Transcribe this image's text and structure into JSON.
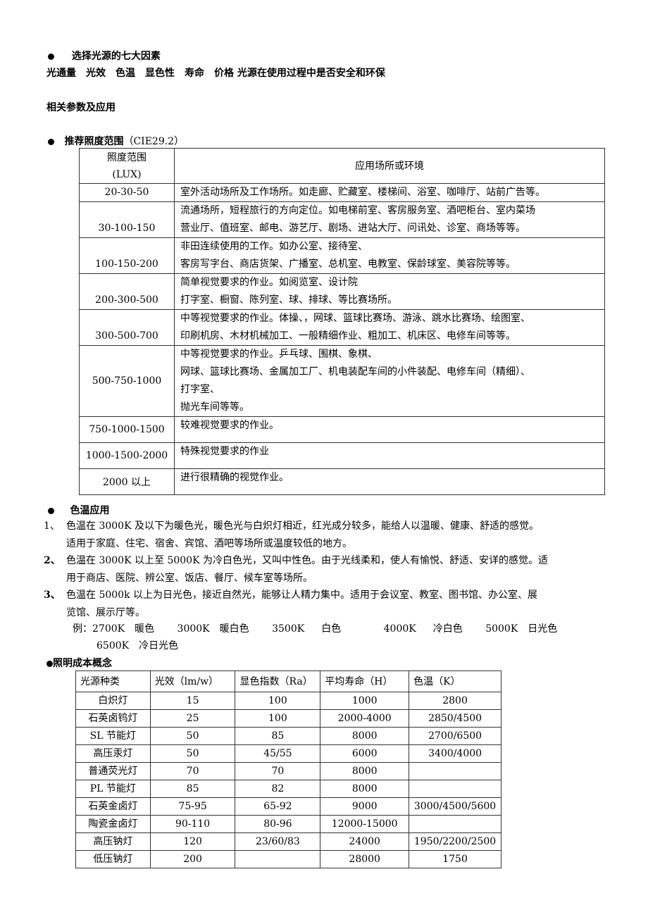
{
  "section1": {
    "title": "选择光源的七大因素",
    "factors_line": "光通量　光效　色温　显色性　寿命　价格 光源在使用过程中是否安全和环保"
  },
  "section2": {
    "title": "相关参数及应用"
  },
  "lux_section": {
    "title": "推荐照度范围",
    "title_suffix": "（CIE29.2）",
    "header": {
      "range_line1": "照度范围",
      "range_line2": "(LUX)",
      "application": "应用场所或环境"
    },
    "rows": [
      {
        "range": "20-30-50",
        "lines": [
          "室外活动场所及工作场所。如走廊、贮藏室、楼梯间、浴室、咖啡厅、站前广告等。"
        ]
      },
      {
        "range": "30-100-150",
        "lines": [
          "流通场所，短程旅行的方向定位。如电梯前室、客房服务室、酒吧柜台、室内菜场",
          "营业厅、值班室、邮电、游艺厅、剧场、进站大厅、问讯处、诊室、商场等等。"
        ]
      },
      {
        "range": "100-150-200",
        "lines": [
          "非田连续使用的工作。如办公室、接待室、",
          "客房写字台、商店货架、广播室、总机室、电教室、保龄球室、美容院等等。"
        ]
      },
      {
        "range": "200-300-500",
        "lines": [
          "简单视觉要求的作业。如阅览室、设计院",
          "打字室、橱窗、陈列室、球、排球、等比赛场所。"
        ]
      },
      {
        "range": "300-500-700",
        "lines": [
          "中等视觉要求的作业。体操、，网球、篮球比赛场、游泳、跳水比赛场、绘图室、",
          "印刷机房、木材机械加工、一般精细作业、粗加工、机床区、电修车间等等。"
        ]
      },
      {
        "range": "500-750-1000",
        "lines": [
          "中等视觉要求的作业。乒乓球、围棋、象棋、",
          "网球、篮球比赛场、金属加工厂、机电装配车间的小件装配、电修车间（精细）、",
          "打字室、",
          "抛光车间等等。"
        ]
      },
      {
        "range": "750-1000-1500",
        "lines": [
          "较难视觉要求的作业。"
        ]
      },
      {
        "range": "1000-1500-2000",
        "lines": [
          "特殊视觉要求的作业"
        ]
      },
      {
        "range": "2000 以上",
        "lines": [
          "进行很精确的视觉作业。"
        ]
      }
    ]
  },
  "color_temp": {
    "title": "色温应用",
    "items": [
      {
        "num": "1、",
        "line1": "色温在 3000K 及以下为暖色光，暖色光与白炽灯相近，红光成分较多，能给人以温暖、健康、舒适的感觉。",
        "line2": "适用于家庭、住宅、宿舍、宾馆、酒吧等场所或温度较低的地方。"
      },
      {
        "num": "2、",
        "line1": "色温在 3000K 以上至 5000K 为冷白色光，又叫中性色。由于光线柔和，使人有愉悦、舒适、安详的感觉。适",
        "line2": "用于商店、医院、辨公室、饭店、餐厅、候车室等场所。"
      },
      {
        "num": "3、",
        "line1": "色温在 5000k 以上为日光色，接近自然光，能够让人精力集中。适用于会议室、教室、图书馆、办公室、展",
        "line2": "览馆、展示厅等。"
      }
    ],
    "example_label": "例：",
    "examples": [
      {
        "k": "2700K",
        "name": "暖色"
      },
      {
        "k": "3000K",
        "name": "暖白色"
      },
      {
        "k": "3500K",
        "name": "白色"
      },
      {
        "k": "4000K",
        "name": "冷白色"
      },
      {
        "k": "5000K",
        "name": "日光色"
      },
      {
        "k": "6500K",
        "name": "冷日光色"
      }
    ]
  },
  "cost_section": {
    "title": "照明成本概念",
    "headers": [
      "光源种类",
      "光效（lm/w）",
      "显色指数（Ra）",
      "平均寿命（H）",
      "色温（K）"
    ],
    "rows": [
      [
        "白炽灯",
        "15",
        "100",
        "1000",
        "2800"
      ],
      [
        "石英卤钨灯",
        "25",
        "100",
        "2000-4000",
        "2850/4500"
      ],
      [
        "SL 节能灯",
        "50",
        "85",
        "8000",
        "2700/6500"
      ],
      [
        "高压汞灯",
        "50",
        "45/55",
        "6000",
        "3400/4000"
      ],
      [
        "普通荧光灯",
        "70",
        "70",
        "8000",
        ""
      ],
      [
        "PL 节能灯",
        "85",
        "82",
        "8000",
        ""
      ],
      [
        "石英金卤灯",
        "75-95",
        "65-92",
        "9000",
        "3000/4500/5600"
      ],
      [
        "陶瓷金卤灯",
        "90-110",
        "80-96",
        "12000-15000",
        ""
      ],
      [
        "高压钠灯",
        "120",
        "23/60/83",
        "24000",
        "1950/2200/2500"
      ],
      [
        "低压钠灯",
        "200",
        "",
        "28000",
        "1750"
      ]
    ]
  }
}
